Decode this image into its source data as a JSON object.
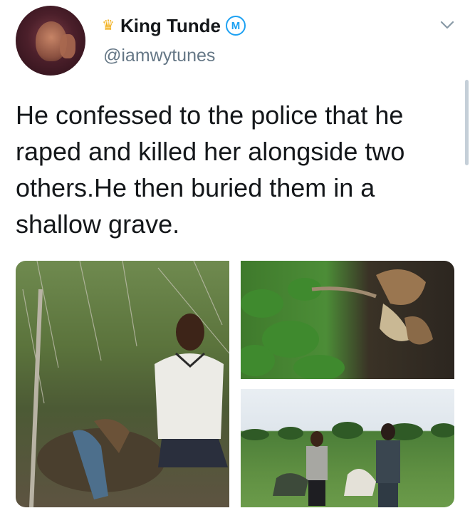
{
  "user": {
    "display_name": "King Tunde",
    "handle": "@iamwytunes",
    "badge_letter": "M",
    "crown_icon": "crown-icon"
  },
  "tweet": {
    "text": "He confessed to the police that he raped and killed her alongside two others.He then buried them in a shallow grave."
  },
  "media": {
    "count": 3
  },
  "colors": {
    "text": "#14171a",
    "secondary": "#657786",
    "accent": "#1da1f2",
    "crown": "#f2b01e"
  }
}
